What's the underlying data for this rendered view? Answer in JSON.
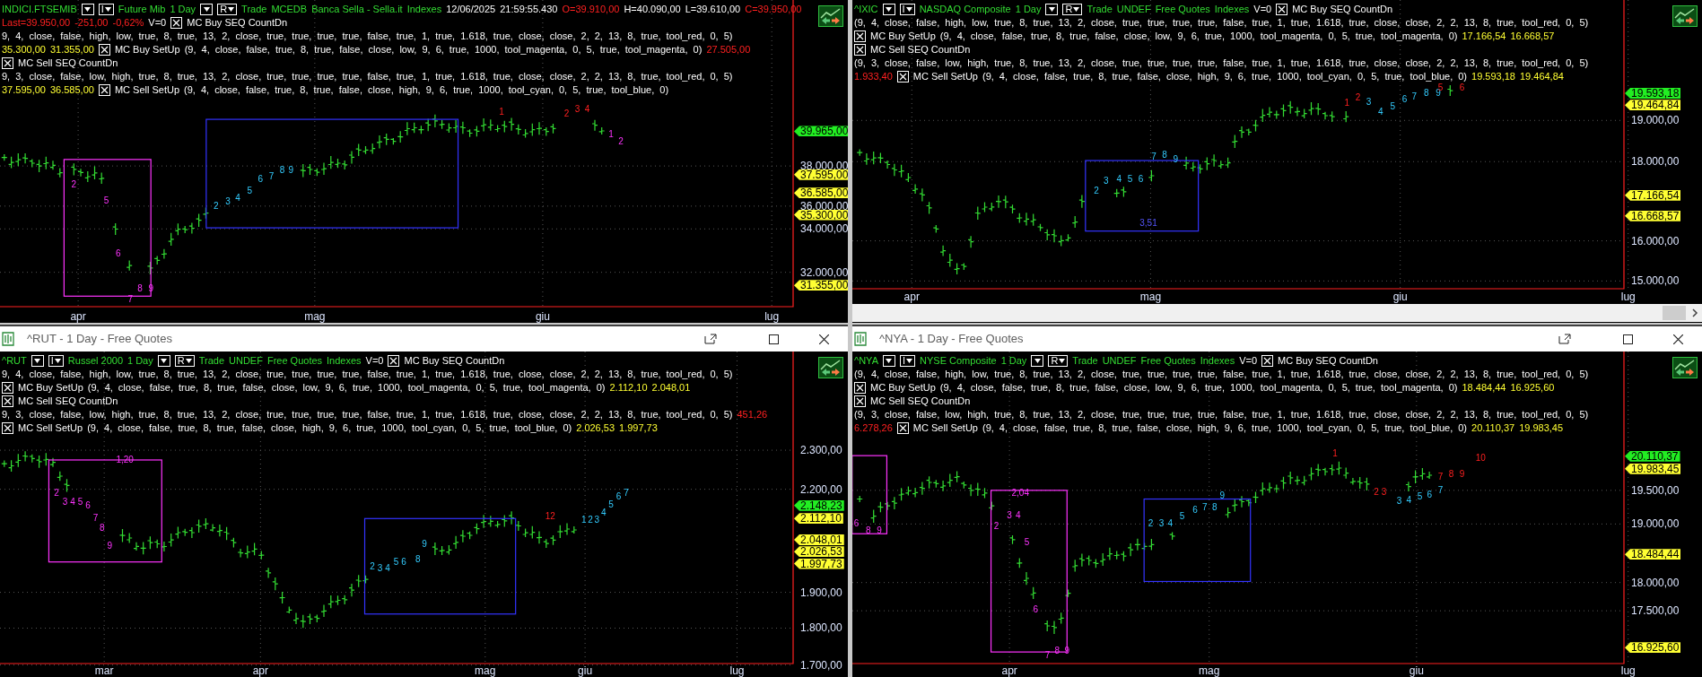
{
  "panels": [
    {
      "header_lines": [
        [
          {
            "kind": "symbol",
            "text": "INDICI.FTSEMIB"
          },
          {
            "kind": "dropdown"
          },
          {
            "kind": "menu",
            "text": "I"
          },
          {
            "kind": "symbol",
            "text": "Future Mib"
          },
          {
            "kind": "symbol",
            "text": "1 Day"
          },
          {
            "kind": "dropdown"
          },
          {
            "kind": "menu",
            "text": "R"
          },
          {
            "kind": "symbol",
            "text": "Trade"
          },
          {
            "kind": "symbol",
            "text": "MCEDB"
          },
          {
            "kind": "symbol",
            "text": "Banca Sella - Sella.it"
          },
          {
            "kind": "symbol",
            "text": "Indexes"
          },
          {
            "kind": "plain",
            "text": "12/06/2025"
          },
          {
            "kind": "plain",
            "text": "21:59:55.430"
          },
          {
            "kind": "negative",
            "text": "O=39.910,00"
          },
          {
            "kind": "plain",
            "text": "H=40.090,00"
          },
          {
            "kind": "plain",
            "text": "L=39.610,00"
          },
          {
            "kind": "negative",
            "text": "C=39.950,00"
          }
        ],
        [
          {
            "kind": "negative",
            "text": "Last=39.950,00"
          },
          {
            "kind": "negative",
            "text": "-251,00"
          },
          {
            "kind": "negative",
            "text": "-0,62%"
          },
          {
            "kind": "plain",
            "text": "V=0"
          },
          {
            "kind": "checkbox",
            "checked": true
          },
          {
            "kind": "plain",
            "text": "MC Buy SEQ CountDn"
          }
        ],
        [
          {
            "kind": "params",
            "text": "9, 4, close, false, high, low, true, 8, true, 13, 2, close, true, true, true, true, false, true, 1, true, 1.618, true, close, close, 2, 2, 13, 8, true, tool_red, 0, 5)"
          }
        ],
        [
          {
            "kind": "level",
            "text": "35.300,00"
          },
          {
            "kind": "level",
            "text": "31.355,00"
          },
          {
            "kind": "checkbox",
            "checked": true
          },
          {
            "kind": "plain",
            "text": "MC Buy SetUp"
          },
          {
            "kind": "params",
            "text": "(9, 4, close, false, true, 8, true, false, close, low, 9, 6, true, 1000, tool_magenta, 0, 5, true, tool_magenta, 0)"
          },
          {
            "kind": "negative",
            "text": "27.505,00"
          }
        ],
        [
          {
            "kind": "checkbox",
            "checked": true
          },
          {
            "kind": "plain",
            "text": "MC Sell SEQ CountDn"
          }
        ],
        [
          {
            "kind": "params",
            "text": "9, 3, close, false, low, high, true, 8, true, 13, 2, close, true, true, true, true, false, true, 1, true, 1.618, true, close, close, 2, 2, 13, 8, true, tool_red, 0, 5)"
          }
        ],
        [
          {
            "kind": "level",
            "text": "37.595,00"
          },
          {
            "kind": "level",
            "text": "36.585,00"
          },
          {
            "kind": "checkbox",
            "checked": true
          },
          {
            "kind": "plain",
            "text": "MC Sell SetUp"
          },
          {
            "kind": "params",
            "text": "(9, 4, close, false, true, 8, true, false, close, high, 9, 6, true, 1000, tool_cyan, 0, 5, true, tool_blue, 0)"
          }
        ]
      ],
      "y_axis": [
        "38.000,00",
        "36.000,00",
        "34.000,00",
        "32.000,00"
      ],
      "price_tags": [
        {
          "text": "39.965,00",
          "kind": "last"
        },
        {
          "text": "37.595,00",
          "kind": "level"
        },
        {
          "text": "36.585,00",
          "kind": "level"
        },
        {
          "text": "35.300,00",
          "kind": "level"
        },
        {
          "text": "31.355,00",
          "kind": "level"
        }
      ],
      "x_axis": [
        "apr",
        "mag",
        "giu",
        "lug"
      ],
      "count_labels": [
        {
          "text": "2",
          "kind": "buy_setup"
        },
        {
          "text": "5",
          "kind": "buy_setup"
        },
        {
          "text": "6",
          "kind": "buy_setup"
        },
        {
          "text": "7",
          "kind": "buy_setup"
        },
        {
          "text": "8",
          "kind": "buy_setup"
        },
        {
          "text": "9",
          "kind": "buy_setup"
        },
        {
          "text": "2",
          "kind": "sell_setup"
        },
        {
          "text": "3",
          "kind": "sell_setup"
        },
        {
          "text": "4",
          "kind": "sell_setup"
        },
        {
          "text": "5",
          "kind": "sell_setup"
        },
        {
          "text": "6",
          "kind": "sell_setup"
        },
        {
          "text": "7",
          "kind": "sell_setup"
        },
        {
          "text": "8",
          "kind": "sell_setup"
        },
        {
          "text": "9",
          "kind": "sell_setup"
        },
        {
          "text": "1",
          "kind": "countdown"
        },
        {
          "text": "2",
          "kind": "countdown"
        },
        {
          "text": "3",
          "kind": "countdown"
        },
        {
          "text": "4",
          "kind": "countdown"
        },
        {
          "text": "1",
          "kind": "buy_setup"
        },
        {
          "text": "2",
          "kind": "buy_setup"
        }
      ],
      "scrollbar": false
    },
    {
      "header_lines": [
        [
          {
            "kind": "symbol",
            "text": "^IXIC"
          },
          {
            "kind": "dropdown"
          },
          {
            "kind": "menu",
            "text": "I"
          },
          {
            "kind": "symbol",
            "text": "NASDAQ Composite"
          },
          {
            "kind": "symbol",
            "text": "1 Day"
          },
          {
            "kind": "dropdown"
          },
          {
            "kind": "menu",
            "text": "R"
          },
          {
            "kind": "symbol",
            "text": "Trade"
          },
          {
            "kind": "symbol",
            "text": "UNDEF"
          },
          {
            "kind": "symbol",
            "text": "Free Quotes"
          },
          {
            "kind": "symbol",
            "text": "Indexes"
          },
          {
            "kind": "plain",
            "text": "V=0"
          },
          {
            "kind": "checkbox",
            "checked": true
          },
          {
            "kind": "plain",
            "text": "MC Buy SEQ CountDn"
          }
        ],
        [
          {
            "kind": "params",
            "text": "(9, 4, close, false, high, low, true, 8, true, 13, 2, close, true, true, true, true, false, true, 1, true, 1.618, true, close, close, 2, 2, 13, 8, true, tool_red, 0, 5)"
          }
        ],
        [
          {
            "kind": "checkbox",
            "checked": true
          },
          {
            "kind": "plain",
            "text": "MC Buy SetUp"
          },
          {
            "kind": "params",
            "text": "(9, 4, close, false, true, 8, true, false, close, low, 9, 6, true, 1000, tool_magenta, 0, 5, true, tool_magenta, 0)"
          },
          {
            "kind": "level",
            "text": "17.166,54"
          },
          {
            "kind": "level",
            "text": "16.668,57"
          }
        ],
        [
          {
            "kind": "checkbox",
            "checked": true
          },
          {
            "kind": "plain",
            "text": "MC Sell SEQ CountDn"
          }
        ],
        [
          {
            "kind": "params",
            "text": "(9, 3, close, false, low, high, true, 8, true, 13, 2, close, true, true, true, true, false, true, 1, true, 1.618, true, close, close, 2, 2, 13, 8, true, tool_red, 0, 5)"
          }
        ],
        [
          {
            "kind": "negative",
            "text": "1.933,40"
          },
          {
            "kind": "checkbox",
            "checked": true
          },
          {
            "kind": "plain",
            "text": "MC Sell SetUp"
          },
          {
            "kind": "params",
            "text": "(9, 4, close, false, true, 8, true, false, close, high, 9, 6, true, 1000, tool_cyan, 0, 5, true, tool_blue, 0)"
          },
          {
            "kind": "level",
            "text": "19.593,18"
          },
          {
            "kind": "level",
            "text": "19.464,84"
          }
        ]
      ],
      "y_axis": [
        "19.000,00",
        "18.000,00",
        "16.000,00",
        "15.000,00"
      ],
      "price_tags": [
        {
          "text": "19.593,18",
          "kind": "last"
        },
        {
          "text": "19.464,84",
          "kind": "level"
        },
        {
          "text": "17.166,54",
          "kind": "level"
        },
        {
          "text": "16.668,57",
          "kind": "level"
        }
      ],
      "x_axis": [
        "apr",
        "mag",
        "giu",
        "lug"
      ],
      "count_labels": [
        {
          "text": "2",
          "kind": "sell_setup"
        },
        {
          "text": "3",
          "kind": "sell_setup"
        },
        {
          "text": "4",
          "kind": "sell_setup"
        },
        {
          "text": "5",
          "kind": "sell_setup"
        },
        {
          "text": "6",
          "kind": "sell_setup"
        },
        {
          "text": "7",
          "kind": "sell_setup"
        },
        {
          "text": "8",
          "kind": "sell_setup"
        },
        {
          "text": "9",
          "kind": "sell_setup"
        },
        {
          "text": "3,51",
          "kind": "risk"
        },
        {
          "text": "1",
          "kind": "countdown"
        },
        {
          "text": "2",
          "kind": "countdown"
        },
        {
          "text": "3",
          "kind": "sell_setup"
        },
        {
          "text": "4",
          "kind": "sell_setup"
        },
        {
          "text": "5",
          "kind": "sell_setup"
        },
        {
          "text": "6",
          "kind": "sell_setup"
        },
        {
          "text": "7",
          "kind": "sell_setup"
        },
        {
          "text": "8",
          "kind": "sell_setup"
        },
        {
          "text": "9",
          "kind": "sell_setup"
        },
        {
          "text": "5",
          "kind": "countdown"
        },
        {
          "text": "6",
          "kind": "countdown"
        }
      ],
      "scrollbar": true
    },
    {
      "title_bar": {
        "title": "^RUT - 1 Day - Free Quotes"
      },
      "header_lines": [
        [
          {
            "kind": "symbol",
            "text": "^RUT"
          },
          {
            "kind": "dropdown"
          },
          {
            "kind": "menu",
            "text": "I"
          },
          {
            "kind": "symbol",
            "text": "Russel 2000"
          },
          {
            "kind": "symbol",
            "text": "1 Day"
          },
          {
            "kind": "dropdown"
          },
          {
            "kind": "menu",
            "text": "R"
          },
          {
            "kind": "symbol",
            "text": "Trade"
          },
          {
            "kind": "symbol",
            "text": "UNDEF"
          },
          {
            "kind": "symbol",
            "text": "Free Quotes"
          },
          {
            "kind": "symbol",
            "text": "Indexes"
          },
          {
            "kind": "plain",
            "text": "V=0"
          },
          {
            "kind": "checkbox",
            "checked": true
          },
          {
            "kind": "plain",
            "text": "MC Buy SEQ CountDn"
          }
        ],
        [
          {
            "kind": "params",
            "text": "9, 4, close, false, high, low, true, 8, true, 13, 2, close, true, true, true, true, false, true, 1, true, 1.618, true, close, close, 2, 2, 13, 8, true, tool_red, 0, 5)"
          }
        ],
        [
          {
            "kind": "checkbox",
            "checked": true
          },
          {
            "kind": "plain",
            "text": "MC Buy SetUp"
          },
          {
            "kind": "params",
            "text": "(9, 4, close, false, true, 8, true, false, close, low, 9, 6, true, 1000, tool_magenta, 0, 5, true, tool_magenta, 0)"
          },
          {
            "kind": "level",
            "text": "2.112,10"
          },
          {
            "kind": "level",
            "text": "2.048,01"
          }
        ],
        [
          {
            "kind": "checkbox",
            "checked": true
          },
          {
            "kind": "plain",
            "text": "MC Sell SEQ CountDn"
          }
        ],
        [
          {
            "kind": "params",
            "text": "9, 3, close, false, low, high, true, 8, true, 13, 2, close, true, true, true, true, false, true, 1, true, 1.618, true, close, close, 2, 2, 13, 8, true, tool_red, 0, 5)"
          },
          {
            "kind": "negative",
            "text": "451,26"
          }
        ],
        [
          {
            "kind": "checkbox",
            "checked": true
          },
          {
            "kind": "plain",
            "text": "MC Sell SetUp"
          },
          {
            "kind": "params",
            "text": "(9, 4, close, false, true, 8, true, false, close, high, 9, 6, true, 1000, tool_cyan, 0, 5, true, tool_blue, 0)"
          },
          {
            "kind": "level",
            "text": "2.026,53"
          },
          {
            "kind": "level",
            "text": "1.997,73"
          }
        ]
      ],
      "y_axis": [
        "2.300,00",
        "2.200,00",
        "1.900,00",
        "1.800,00",
        "1.700,00"
      ],
      "price_tags": [
        {
          "text": "2.148,23",
          "kind": "last"
        },
        {
          "text": "2.112,10",
          "kind": "level"
        },
        {
          "text": "2.048,01",
          "kind": "level"
        },
        {
          "text": "2.026,53",
          "kind": "level"
        },
        {
          "text": "1.997,73",
          "kind": "level"
        }
      ],
      "x_axis": [
        "mar",
        "apr",
        "mag",
        "giu",
        "lug"
      ],
      "count_labels": [
        {
          "text": "1,20",
          "kind": "buy_setup"
        },
        {
          "text": "2",
          "kind": "buy_setup"
        },
        {
          "text": "3",
          "kind": "buy_setup"
        },
        {
          "text": "4",
          "kind": "buy_setup"
        },
        {
          "text": "5",
          "kind": "buy_setup"
        },
        {
          "text": "6",
          "kind": "buy_setup"
        },
        {
          "text": "7",
          "kind": "buy_setup"
        },
        {
          "text": "8",
          "kind": "buy_setup"
        },
        {
          "text": "9",
          "kind": "buy_setup"
        },
        {
          "text": "2",
          "kind": "sell_setup"
        },
        {
          "text": "3",
          "kind": "sell_setup"
        },
        {
          "text": "4",
          "kind": "sell_setup"
        },
        {
          "text": "5",
          "kind": "sell_setup"
        },
        {
          "text": "6",
          "kind": "sell_setup"
        },
        {
          "text": "8",
          "kind": "sell_setup"
        },
        {
          "text": "9",
          "kind": "sell_setup"
        },
        {
          "text": "12",
          "kind": "countdown"
        },
        {
          "text": "1",
          "kind": "sell_setup"
        },
        {
          "text": "2",
          "kind": "sell_setup"
        },
        {
          "text": "3",
          "kind": "sell_setup"
        },
        {
          "text": "4",
          "kind": "sell_setup"
        },
        {
          "text": "5",
          "kind": "sell_setup"
        },
        {
          "text": "6",
          "kind": "sell_setup"
        },
        {
          "text": "7",
          "kind": "sell_setup"
        }
      ],
      "scrollbar": false
    },
    {
      "title_bar": {
        "title": "^NYA - 1 Day - Free Quotes"
      },
      "header_lines": [
        [
          {
            "kind": "symbol",
            "text": "^NYA"
          },
          {
            "kind": "dropdown"
          },
          {
            "kind": "menu",
            "text": "I"
          },
          {
            "kind": "symbol",
            "text": "NYSE Composite"
          },
          {
            "kind": "symbol",
            "text": "1 Day"
          },
          {
            "kind": "dropdown"
          },
          {
            "kind": "menu",
            "text": "R"
          },
          {
            "kind": "symbol",
            "text": "Trade"
          },
          {
            "kind": "symbol",
            "text": "UNDEF"
          },
          {
            "kind": "symbol",
            "text": "Free Quotes"
          },
          {
            "kind": "symbol",
            "text": "Indexes"
          },
          {
            "kind": "plain",
            "text": "V=0"
          },
          {
            "kind": "checkbox",
            "checked": true
          },
          {
            "kind": "plain",
            "text": "MC Buy SEQ CountDn"
          }
        ],
        [
          {
            "kind": "params",
            "text": "(9, 4, close, false, high, low, true, 8, true, 13, 2, close, true, true, true, true, false, true, 1, true, 1.618, true, close, close, 2, 2, 13, 8, true, tool_red, 0, 5)"
          }
        ],
        [
          {
            "kind": "checkbox",
            "checked": true
          },
          {
            "kind": "plain",
            "text": "MC Buy SetUp"
          },
          {
            "kind": "params",
            "text": "(9, 4, close, false, true, 8, true, false, close, low, 9, 6, true, 1000, tool_magenta, 0, 5, true, tool_magenta, 0)"
          },
          {
            "kind": "level",
            "text": "18.484,44"
          },
          {
            "kind": "level",
            "text": "16.925,60"
          }
        ],
        [
          {
            "kind": "checkbox",
            "checked": true
          },
          {
            "kind": "plain",
            "text": "MC Sell SEQ CountDn"
          }
        ],
        [
          {
            "kind": "params",
            "text": "(9, 3, close, false, low, high, true, 8, true, 13, 2, close, true, true, true, true, false, true, 1, true, 1.618, true, close, close, 2, 2, 13, 8, true, tool_red, 0, 5)"
          }
        ],
        [
          {
            "kind": "negative",
            "text": "6.278,26"
          },
          {
            "kind": "checkbox",
            "checked": true
          },
          {
            "kind": "plain",
            "text": "MC Sell SetUp"
          },
          {
            "kind": "params",
            "text": "(9, 4, close, false, true, 8, true, false, close, high, 9, 6, true, 1000, tool_cyan, 0, 5, true, tool_blue, 0)"
          },
          {
            "kind": "level",
            "text": "20.110,37"
          },
          {
            "kind": "level",
            "text": "19.983,45"
          }
        ]
      ],
      "y_axis": [
        "19.500,00",
        "19.000,00",
        "18.000,00",
        "17.500,00"
      ],
      "price_tags": [
        {
          "text": "20.110,37",
          "kind": "last"
        },
        {
          "text": "19.983,45",
          "kind": "level"
        },
        {
          "text": "18.484,44",
          "kind": "level"
        },
        {
          "text": "16.925,60",
          "kind": "level"
        }
      ],
      "x_axis": [
        "apr",
        "mag",
        "giu",
        "lug"
      ],
      "count_labels": [
        {
          "text": "6",
          "kind": "buy_setup"
        },
        {
          "text": "8",
          "kind": "buy_setup"
        },
        {
          "text": "9",
          "kind": "buy_setup"
        },
        {
          "text": "2,04",
          "kind": "buy_setup"
        },
        {
          "text": "2",
          "kind": "buy_setup"
        },
        {
          "text": "3",
          "kind": "buy_setup"
        },
        {
          "text": "4",
          "kind": "buy_setup"
        },
        {
          "text": "5",
          "kind": "buy_setup"
        },
        {
          "text": "6",
          "kind": "buy_setup"
        },
        {
          "text": "7",
          "kind": "buy_setup"
        },
        {
          "text": "8",
          "kind": "buy_setup"
        },
        {
          "text": "9",
          "kind": "buy_setup"
        },
        {
          "text": "2",
          "kind": "sell_setup"
        },
        {
          "text": "3",
          "kind": "sell_setup"
        },
        {
          "text": "4",
          "kind": "sell_setup"
        },
        {
          "text": "5",
          "kind": "sell_setup"
        },
        {
          "text": "6",
          "kind": "sell_setup"
        },
        {
          "text": "7",
          "kind": "sell_setup"
        },
        {
          "text": "8",
          "kind": "sell_setup"
        },
        {
          "text": "9",
          "kind": "sell_setup"
        },
        {
          "text": "1",
          "kind": "countdown"
        },
        {
          "text": "2",
          "kind": "countdown"
        },
        {
          "text": "3",
          "kind": "countdown"
        },
        {
          "text": "3",
          "kind": "sell_setup"
        },
        {
          "text": "4",
          "kind": "sell_setup"
        },
        {
          "text": "5",
          "kind": "sell_setup"
        },
        {
          "text": "6",
          "kind": "sell_setup"
        },
        {
          "text": "7",
          "kind": "sell_setup"
        },
        {
          "text": "7",
          "kind": "countdown"
        },
        {
          "text": "8",
          "kind": "countdown"
        },
        {
          "text": "9",
          "kind": "countdown"
        },
        {
          "text": "10",
          "kind": "countdown"
        }
      ],
      "scrollbar": false
    }
  ]
}
